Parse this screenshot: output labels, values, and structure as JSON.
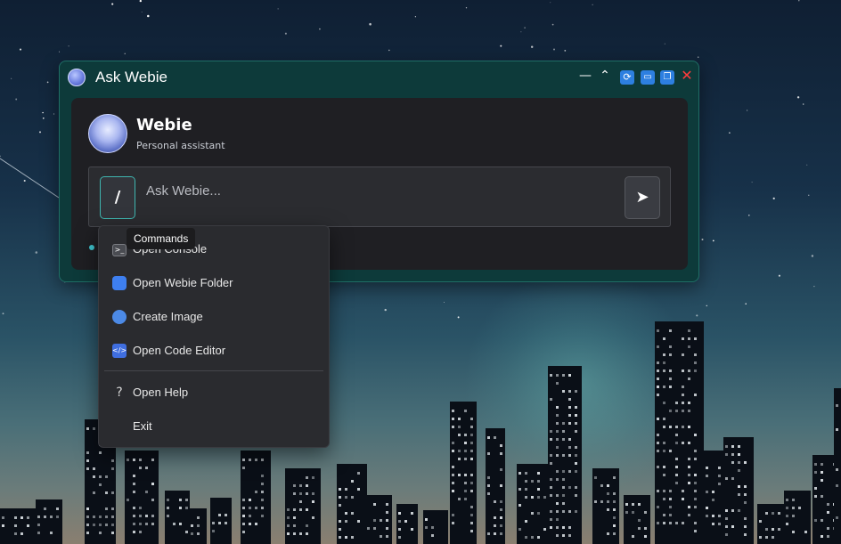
{
  "window": {
    "title": "Ask Webie",
    "buttons": {
      "minimize": "—",
      "collapse": "⌃",
      "refresh": "⟳",
      "frame": "▭",
      "restore": "❐",
      "close": "✕"
    }
  },
  "assistant": {
    "name": "Webie",
    "subtitle": "Personal assistant"
  },
  "input": {
    "command_button": "/",
    "placeholder": "Ask Webie...",
    "value": "",
    "send_label": "➤"
  },
  "tooltip": {
    "text": "Commands"
  },
  "menu": {
    "items": [
      {
        "label": "Open Console",
        "icon": "console-icon"
      },
      {
        "label": "Open Webie Folder",
        "icon": "folder-icon"
      },
      {
        "label": "Create Image",
        "icon": "image-icon"
      },
      {
        "label": "Open Code Editor",
        "icon": "code-icon"
      },
      {
        "label": "Open Help",
        "icon": "help-icon"
      },
      {
        "label": "Exit",
        "icon": ""
      }
    ]
  },
  "colors": {
    "window_bg": "#0d3a3a",
    "accent": "#3fb6b0",
    "close": "#ff3b3b"
  }
}
